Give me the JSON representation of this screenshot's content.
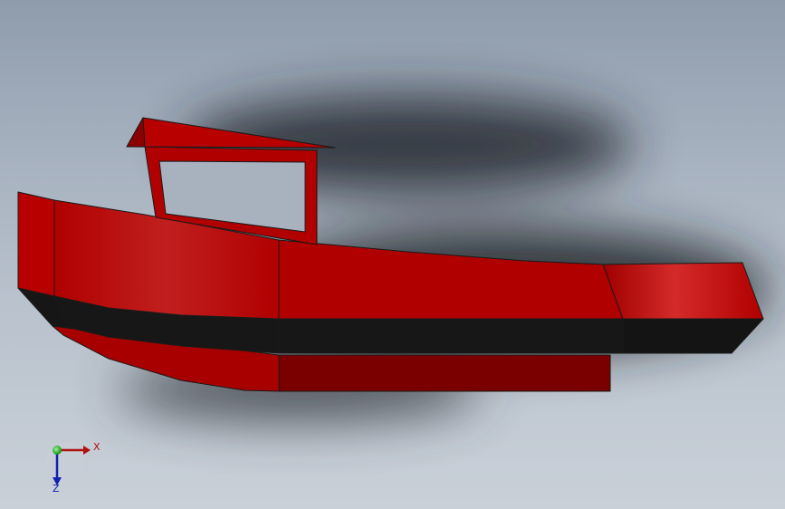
{
  "viewport": {
    "background_top": "#8f9cac",
    "background_bottom": "#c9d0d8"
  },
  "model": {
    "hull_color": "#b00000",
    "hull_highlight": "#d42a2a",
    "hull_dark": "#7a0000",
    "band_color": "#171717",
    "edge_color": "#1a1a1a"
  },
  "triad": {
    "x_label": "X",
    "z_label": "Z",
    "x_color": "#b01010",
    "y_color": "#10b010",
    "z_color": "#1020b0"
  }
}
